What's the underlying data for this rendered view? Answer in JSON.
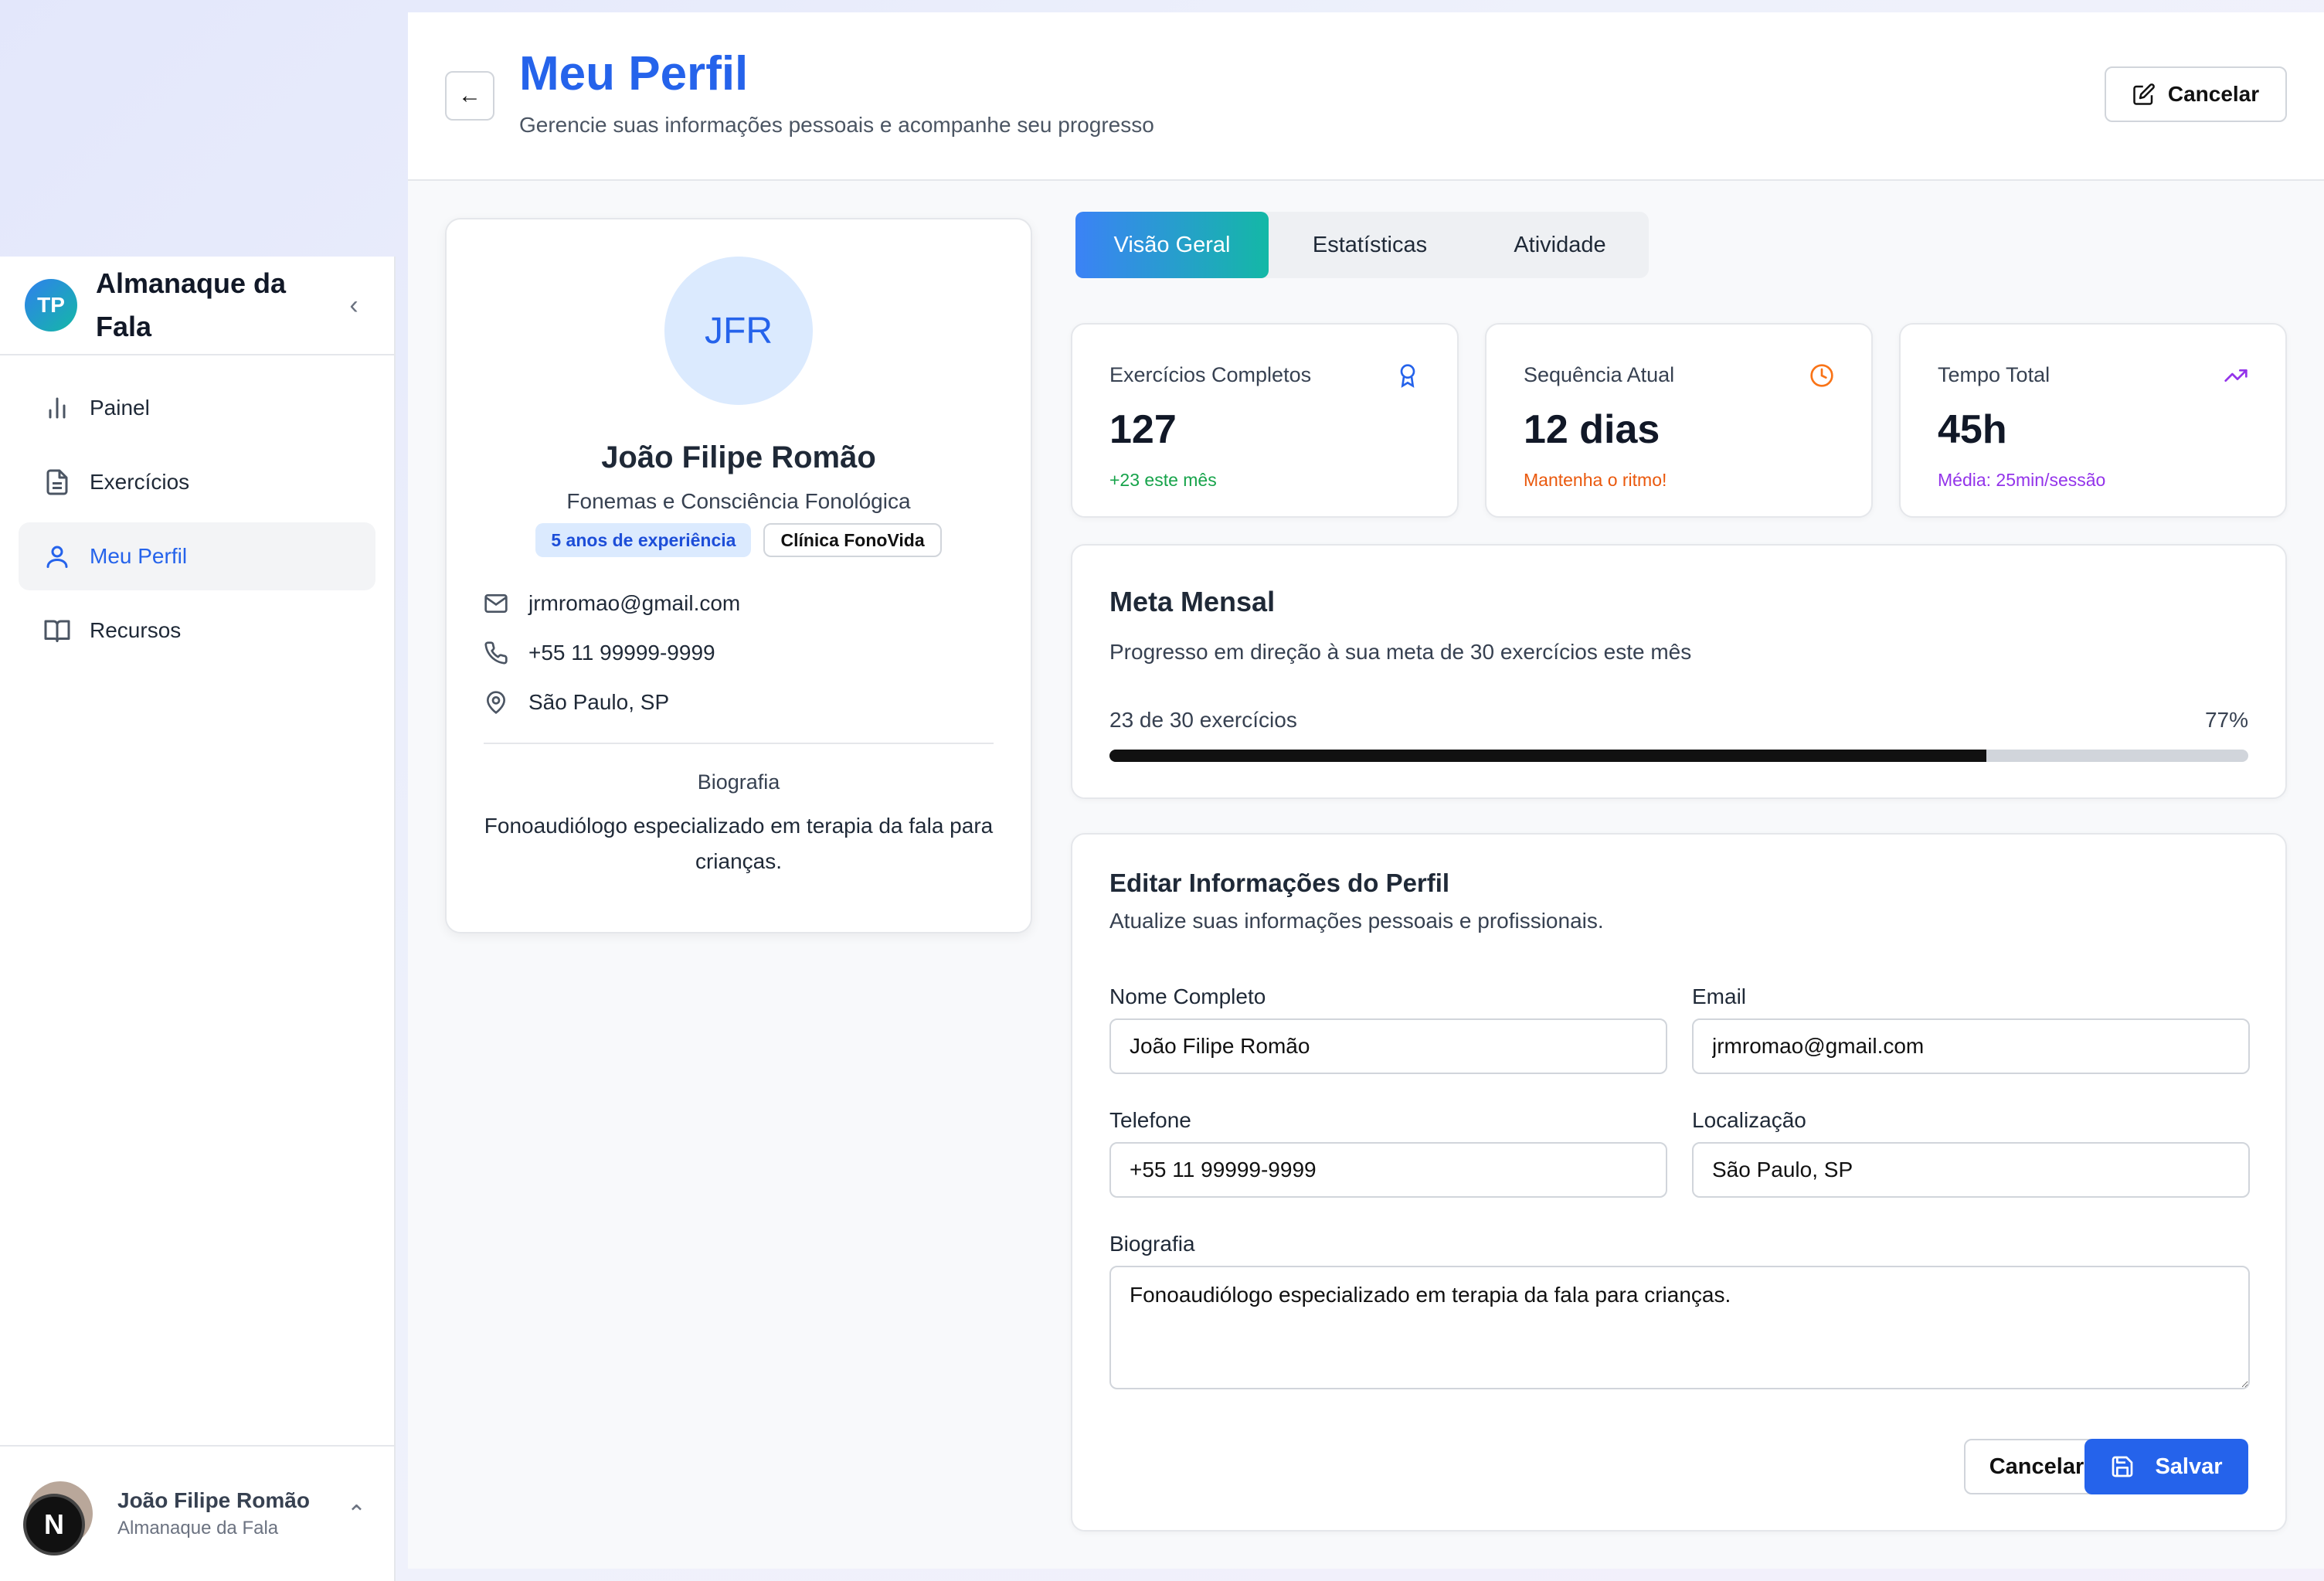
{
  "sidebar": {
    "logo_initials": "TP",
    "app_name": "Almanaque da Fala",
    "collapse_icon": "‹",
    "items": [
      {
        "label": "Painel",
        "icon": "bar-chart-icon"
      },
      {
        "label": "Exercícios",
        "icon": "document-icon"
      },
      {
        "label": "Meu Perfil",
        "icon": "user-icon",
        "active": true
      },
      {
        "label": "Recursos",
        "icon": "book-icon"
      }
    ],
    "user": {
      "name": "João Filipe Romão",
      "org": "Almanaque da Fala",
      "badge": "N",
      "chevron": "⌃"
    }
  },
  "header": {
    "back_icon": "←",
    "title": "Meu Perfil",
    "subtitle": "Gerencie suas informações pessoais e acompanhe seu progresso",
    "cancel_label": "Cancelar"
  },
  "profile": {
    "initials": "JFR",
    "name": "João Filipe Romão",
    "specialty": "Fonemas e Consciência Fonológica",
    "badges": [
      "5 anos de experiência",
      "Clínica FonoVida"
    ],
    "email": "jrmromao@gmail.com",
    "phone": "+55 11 99999-9999",
    "location": "São Paulo, SP",
    "bio_label": "Biografia",
    "bio": "Fonoaudiólogo especializado em terapia da fala para crianças."
  },
  "tabs": [
    {
      "label": "Visão Geral",
      "active": true
    },
    {
      "label": "Estatísticas"
    },
    {
      "label": "Atividade"
    }
  ],
  "stats": [
    {
      "title": "Exercícios Completos",
      "value": "127",
      "note": "+23 este mês",
      "icon": "award-icon",
      "color": "#16a34a",
      "icon_color": "#2563eb"
    },
    {
      "title": "Sequência Atual",
      "value": "12 dias",
      "note": "Mantenha o ritmo!",
      "icon": "clock-icon",
      "color": "#ea580c",
      "icon_color": "#f97316"
    },
    {
      "title": "Tempo Total",
      "value": "45h",
      "note": "Média: 25min/sessão",
      "icon": "trending-up-icon",
      "color": "#9333ea",
      "icon_color": "#9333ea"
    }
  ],
  "goal": {
    "title": "Meta Mensal",
    "description": "Progresso em direção à sua meta de 30 exercícios este mês",
    "count_text": "23 de 30 exercícios",
    "percent_text": "77%",
    "progress": 0.77
  },
  "edit": {
    "title": "Editar Informações do Perfil",
    "description": "Atualize suas informações pessoais e profissionais.",
    "fields": {
      "name_label": "Nome Completo",
      "name_value": "João Filipe Romão",
      "email_label": "Email",
      "email_value": "jrmromao@gmail.com",
      "phone_label": "Telefone",
      "phone_value": "+55 11 99999-9999",
      "location_label": "Localização",
      "location_value": "São Paulo, SP",
      "bio_label": "Biografia",
      "bio_value": "Fonoaudiólogo especializado em terapia da fala para crianças."
    },
    "cancel_label": "Cancelar",
    "save_label": "Salvar"
  }
}
